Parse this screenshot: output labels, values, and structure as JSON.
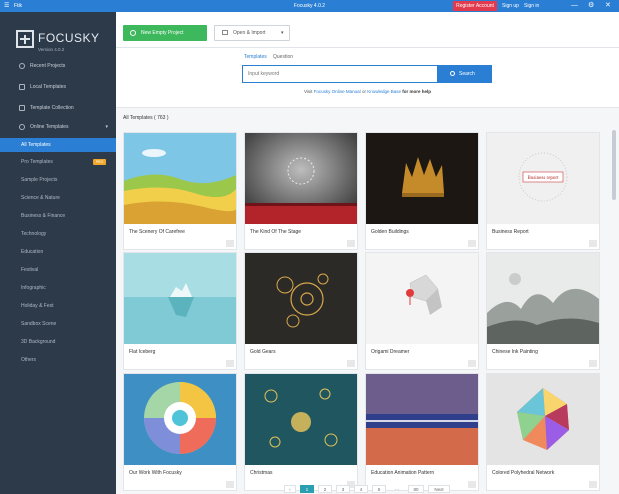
{
  "titlebar": {
    "app_glyph": "☰",
    "app_label": "Ftik",
    "window_title": "Focusky 4.0.2",
    "register": "Register Account",
    "signup": "Sign up",
    "signin": "Sign in",
    "minimize": "—",
    "settings": "⚙",
    "close": "✕"
  },
  "sidebar": {
    "logo_name": "FOCUSKY",
    "logo_version": "Version 4.0.2",
    "nav": [
      {
        "label": "Recent Projects"
      },
      {
        "label": "Local Templates"
      },
      {
        "label": "Template Collection"
      },
      {
        "label": "Online Templates",
        "caret": "▾"
      }
    ],
    "categories": [
      {
        "label": "All Templates"
      },
      {
        "label": "Pro Templates",
        "badge": "PRO"
      },
      {
        "label": "Sample Projects"
      },
      {
        "label": "Science & Nature"
      },
      {
        "label": "Business & Finance"
      },
      {
        "label": "Technology"
      },
      {
        "label": "Education"
      },
      {
        "label": "Festival"
      },
      {
        "label": "Infographic"
      },
      {
        "label": "Holiday & Fest"
      },
      {
        "label": "Sandbox Scene"
      },
      {
        "label": "3D Background"
      },
      {
        "label": "Others"
      }
    ]
  },
  "toolbar": {
    "new_project": "New Empty Project",
    "open_import": "Open & Import",
    "open_caret": "▾"
  },
  "search": {
    "tab_templates": "Templates",
    "tab_question": "Question",
    "placeholder": "Input keyword",
    "button": "Search",
    "help_prefix": "Visit",
    "help_link1": "Focusky Online Manual",
    "help_or": "or",
    "help_link2": "Knowledge Base",
    "help_suffix": "for more help"
  },
  "section_title": "All Templates ( 763 )",
  "templates": [
    {
      "title": "The Scenery Of Carefree"
    },
    {
      "title": "The Kind Of The Stage"
    },
    {
      "title": "Golden Buildings"
    },
    {
      "title": "Business Report"
    },
    {
      "title": "Flat Iceberg"
    },
    {
      "title": "Gold Gears"
    },
    {
      "title": "Origami Dreamer"
    },
    {
      "title": "Chinese Ink Painting"
    },
    {
      "title": "Our Work With Focusky"
    },
    {
      "title": "Christmas"
    },
    {
      "title": "Education Animation Pattern"
    },
    {
      "title": "Colored Polyhedral Network"
    }
  ],
  "thumb_texts": {
    "business_report": "Business report"
  },
  "pager": {
    "prev": "‹",
    "pages": [
      "1",
      "2",
      "3",
      "4",
      "5"
    ],
    "ellipsis": "…",
    "last": "80",
    "next": "Next"
  },
  "colors": {
    "accent": "#2a7fd4",
    "sidebar": "#2d3a4a",
    "new_project": "#3db85c",
    "register": "#e23b4e",
    "pro_badge": "#f0a72a"
  }
}
